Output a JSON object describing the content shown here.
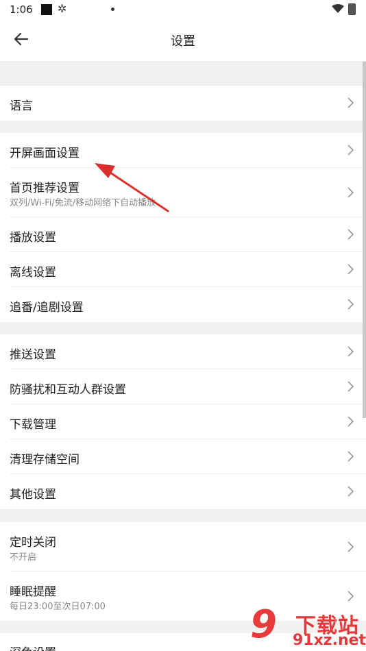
{
  "status_bar": {
    "time": "1:06"
  },
  "header": {
    "title": "设置"
  },
  "items": [
    {
      "label": "语言"
    },
    {
      "label": "开屏画面设置"
    },
    {
      "label": "首页推荐设置",
      "sub": "双列/Wi-Fi/免流/移动网络下自动播放"
    },
    {
      "label": "播放设置"
    },
    {
      "label": "离线设置"
    },
    {
      "label": "追番/追剧设置"
    },
    {
      "label": "推送设置"
    },
    {
      "label": "防骚扰和互动人群设置"
    },
    {
      "label": "下载管理"
    },
    {
      "label": "清理存储空间"
    },
    {
      "label": "其他设置"
    },
    {
      "label": "定时关闭",
      "sub": "不开启"
    },
    {
      "label": "睡眠提醒",
      "sub": "每日23:00至次日07:00"
    },
    {
      "label": "深色设置"
    }
  ],
  "watermark": {
    "logo": "9",
    "title": "下载站",
    "site": "91xz.net"
  },
  "colors": {
    "accent_red": "#e23a3a",
    "background": "#f1f1f2",
    "arrow": "#d9302e"
  }
}
